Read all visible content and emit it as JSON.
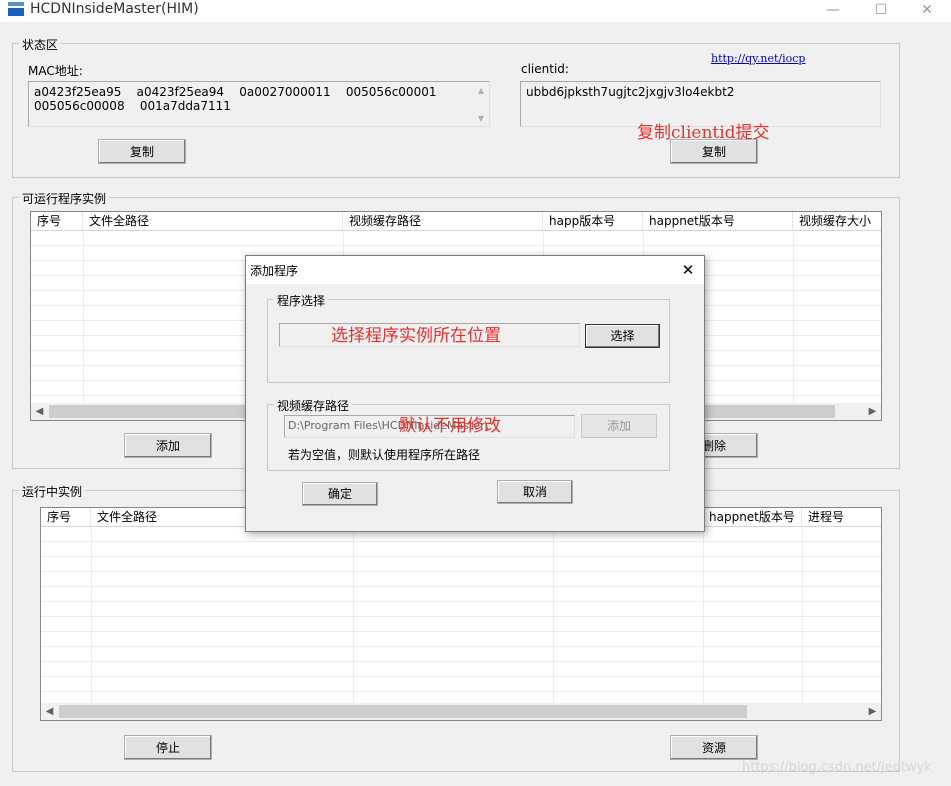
{
  "window": {
    "title": "HCDNInsideMaster(HIM)",
    "icon_label": "HCDN",
    "min_glyph": "—",
    "max_glyph": "☐",
    "close_glyph": "✕"
  },
  "status": {
    "group_title": "状态区",
    "mac_label": "MAC地址:",
    "mac_lines": [
      "a0423f25ea95    a0423f25ea94    0a0027000011    005056c00001",
      "005056c00008    001a7dda7111"
    ],
    "mac_copy": "复制",
    "link": "http://qy.net/iocp",
    "clientid_label": "clientid:",
    "clientid_value": "ubbd6jpksth7ugjtc2jxgjv3lo4ekbt2",
    "clientid_copy": "复制",
    "annotation": "复制clientid提交"
  },
  "runnable": {
    "group_title": "可运行程序实例",
    "columns": [
      "序号",
      "文件全路径",
      "视频缓存路径",
      "happ版本号",
      "happnet版本号",
      "视频缓存大小"
    ],
    "add_button": "添加",
    "delete_button": "删除"
  },
  "running": {
    "group_title": "运行中实例",
    "columns": [
      "序号",
      "文件全路径",
      "",
      "",
      "happnet版本号",
      "进程号"
    ],
    "stop_button": "停止",
    "resource_button": "资源"
  },
  "dialog": {
    "title": "添加程序",
    "close_glyph": "✕",
    "program_group": "程序选择",
    "program_path": "",
    "select_button": "选择",
    "program_annotation": "选择程序实例所在位置",
    "cache_group": "视频缓存路径",
    "cache_path": "D:\\Program Files\\HCDNInsideMaster\\",
    "add_button": "添加",
    "cache_annotation": "默认不用修改",
    "hint": "若为空值，则默认使用程序所在路径",
    "ok_button": "确定",
    "cancel_button": "取消"
  },
  "watermark": "https://blog.csdn.net/jedtwyk"
}
